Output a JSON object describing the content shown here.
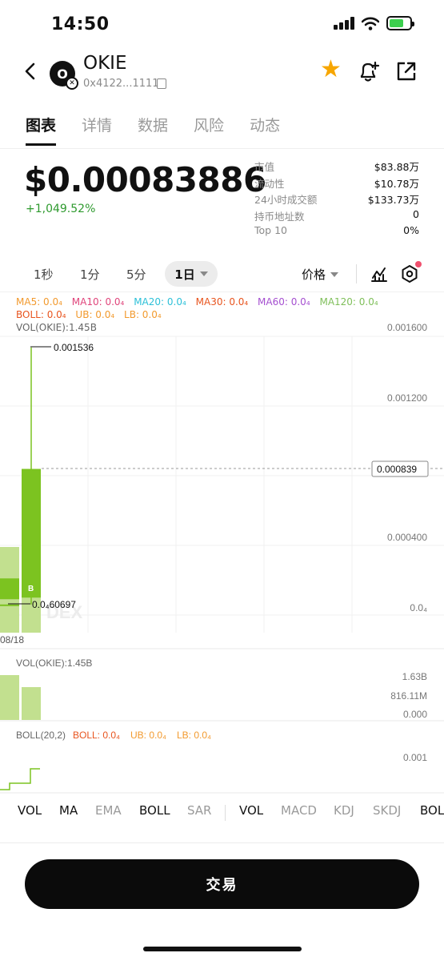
{
  "status": {
    "time": "14:50"
  },
  "header": {
    "token_logo_text": "O",
    "token_name": "OKIE",
    "token_address": "0x4122...1111"
  },
  "tabs": [
    {
      "label": "图表",
      "active": true
    },
    {
      "label": "详情",
      "active": false
    },
    {
      "label": "数据",
      "active": false
    },
    {
      "label": "风险",
      "active": false
    },
    {
      "label": "动态",
      "active": false
    }
  ],
  "price": {
    "value": "$0.00083886",
    "change": "+1,049.52%"
  },
  "stats": [
    {
      "label": "市值",
      "value": "$83.88万"
    },
    {
      "label": "流动性",
      "value": "$10.78万"
    },
    {
      "label": "24小时成交额",
      "value": "$133.73万"
    },
    {
      "label": "持币地址数",
      "value": "0"
    },
    {
      "label": "Top 10",
      "value": "0%"
    }
  ],
  "timeframes": {
    "options": [
      "1秒",
      "1分",
      "5分"
    ],
    "selected": "1日",
    "price_mode": "价格"
  },
  "ma_legend": [
    {
      "label": "MA5: 0.0₄",
      "color": "#f29a2e"
    },
    {
      "label": "MA10: 0.0₄",
      "color": "#e0457b"
    },
    {
      "label": "MA20: 0.0₄",
      "color": "#2cc0d8"
    },
    {
      "label": "MA30: 0.0₄",
      "color": "#e8541e"
    },
    {
      "label": "MA60: 0.0₄",
      "color": "#a54fd0"
    },
    {
      "label": "MA120: 0.0₄",
      "color": "#7fbf5a"
    }
  ],
  "boll_legend": [
    {
      "label": "BOLL: 0.0₄",
      "color": "#e8541e"
    },
    {
      "label": "UB: 0.0₄",
      "color": "#f29a2e"
    },
    {
      "label": "LB: 0.0₄",
      "color": "#f29a2e"
    }
  ],
  "main_chart": {
    "vol_label": "VOL(OKIE):1.45B",
    "y_ticks": [
      "0.001600",
      "0.001200",
      "0.000400",
      "0.0₄"
    ],
    "current_price_tag": "0.000839",
    "high_label": "0.001536",
    "low_label": "0.0₄60697",
    "buy_marker": "B",
    "date_label": "08/18",
    "watermark": "DEX"
  },
  "chart_data": {
    "type": "candlestick",
    "candles": [
      {
        "open": 6.07e-05,
        "high": 6.07e-05,
        "low": 6.07e-05,
        "close": 6.07e-05,
        "role": "previous"
      },
      {
        "open": 0.0001,
        "high": 0.001536,
        "low": 6.07e-05,
        "close": 0.000839,
        "role": "current"
      }
    ],
    "high": 0.001536,
    "low": 6.07e-05,
    "last_price": 0.000839,
    "y_axis_ticks": [
      0.0016,
      0.0012,
      0.0004,
      0
    ],
    "date": "08/18"
  },
  "volume_panel": {
    "label": "VOL(OKIE):1.45B",
    "ticks": [
      "1.63B",
      "816.11M",
      "0.000"
    ]
  },
  "boll_panel": {
    "label": "BOLL(20,2)",
    "legend": [
      {
        "label": "BOLL: 0.0₄",
        "color": "#e8541e"
      },
      {
        "label": "UB: 0.0₄",
        "color": "#f29a2e"
      },
      {
        "label": "LB: 0.0₄",
        "color": "#f29a2e"
      }
    ],
    "tick": "0.001"
  },
  "indicator_tabs": [
    {
      "label": "VOL",
      "active": true
    },
    {
      "label": "MA",
      "active": true
    },
    {
      "label": "EMA",
      "active": false
    },
    {
      "label": "BOLL",
      "active": true
    },
    {
      "label": "SAR",
      "active": false
    },
    {
      "label": "VOL",
      "active": true
    },
    {
      "label": "MACD",
      "active": false
    },
    {
      "label": "KDJ",
      "active": false
    },
    {
      "label": "SKDJ",
      "active": false
    },
    {
      "label": "BOL",
      "active": true
    }
  ],
  "trade_button": "交易",
  "colors": {
    "up": "#7cc320",
    "up_light": "#c2e08f",
    "accent_star": "#f7a600",
    "change_green": "#2e9a2e"
  }
}
